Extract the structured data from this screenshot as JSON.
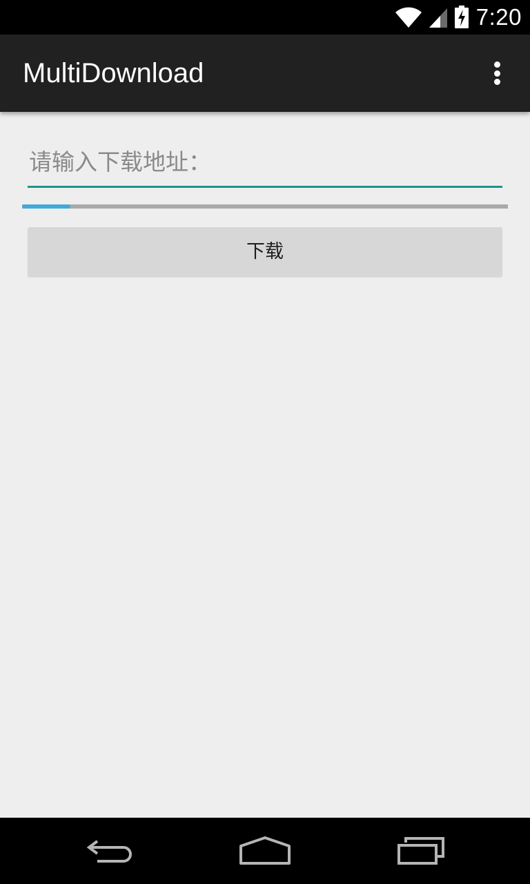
{
  "status_bar": {
    "time": "7:20",
    "icons": [
      "wifi-icon",
      "cell-signal-icon",
      "battery-charging-icon"
    ]
  },
  "action_bar": {
    "title": "MultiDownload",
    "overflow_icon": "overflow-menu-icon"
  },
  "form": {
    "url_placeholder": "请输入下载地址：",
    "url_value": "",
    "progress": 0.1,
    "download_label": "下载"
  },
  "nav_bar": {
    "icons": [
      "back-icon",
      "home-icon",
      "recents-icon"
    ]
  },
  "colors": {
    "action_bar": "#212121",
    "background": "#eeeeee",
    "field_underline": "#1a9688",
    "progress_fill": "#42a9d9",
    "progress_track": "#a9a9a9",
    "button": "#d7d7d7"
  }
}
